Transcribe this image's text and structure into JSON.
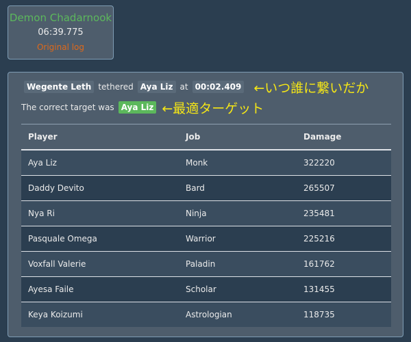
{
  "card": {
    "title": "Demon Chadarnook",
    "time": "06:39.775",
    "link": "Original log"
  },
  "tether": {
    "source": "Wegente Leth",
    "verb": "tethered",
    "target": "Aya Liz",
    "at": "at",
    "timestamp": "00:02.409",
    "note": "←いつ誰に繋いだか"
  },
  "correct": {
    "label": "The correct target was",
    "target": "Aya Liz",
    "note": "←最適ターゲット"
  },
  "table": {
    "headers": [
      "Player",
      "Job",
      "Damage"
    ],
    "rows": [
      [
        "Aya Liz",
        "Monk",
        "322220"
      ],
      [
        "Daddy Devito",
        "Bard",
        "265507"
      ],
      [
        "Nya Ri",
        "Ninja",
        "235481"
      ],
      [
        "Pasquale Omega",
        "Warrior",
        "225216"
      ],
      [
        "Voxfall Valerie",
        "Paladin",
        "161762"
      ],
      [
        "Ayesa Faile",
        "Scholar",
        "131455"
      ],
      [
        "Keya Koizumi",
        "Astrologian",
        "118735"
      ]
    ]
  },
  "colors": {
    "background": "#2b3e50",
    "panel": "#4e5d6c",
    "success": "#5cb85c",
    "link": "#df691a",
    "annotation": "#f5e616"
  }
}
